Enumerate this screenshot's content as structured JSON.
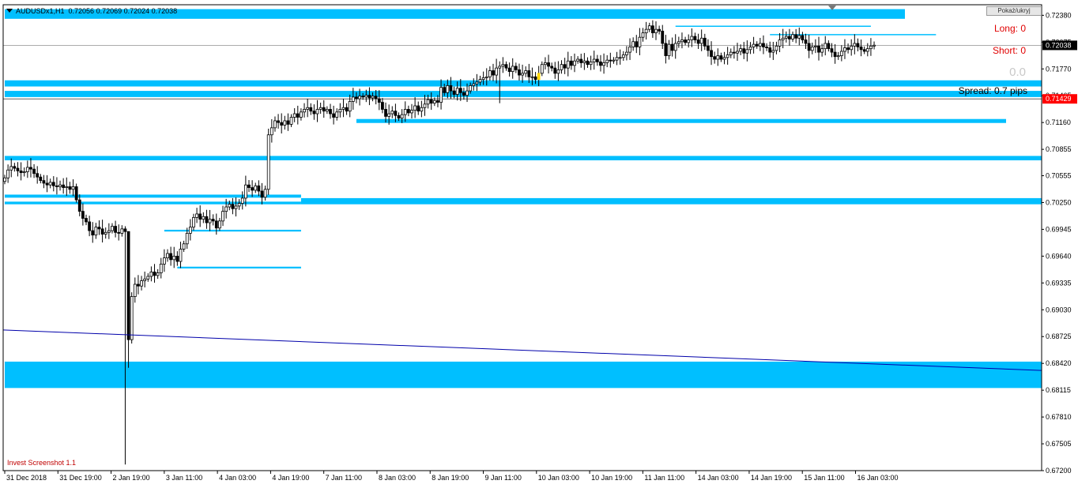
{
  "header": {
    "symbol": "AUDUSDx1,H1",
    "ohlc": "0.72056 0.72069 0.72024 0.72038"
  },
  "toggle_label": "Pokaż/ukryj",
  "panel": {
    "long": "Long: 0",
    "short": "Short: 0",
    "pips_value": "0.0",
    "spread": "Spread: 0.7 pips"
  },
  "branding": "Invest Screenshot 1.1",
  "colors": {
    "zone": "#00bfff",
    "bull": "#ffffff",
    "bear": "#000000",
    "trendline": "#0000aa",
    "current_price_tag": "#000000",
    "red_tag": "#ff0000",
    "pending_candle": "#ffd700"
  },
  "chart_data": {
    "type": "candlestick",
    "symbol": "AUDUSDx1",
    "timeframe": "H1",
    "ylim": [
      0.672,
      0.725
    ],
    "price_ticks": [
      "0.72380",
      "0.72075",
      "0.71770",
      "0.71465",
      "0.71160",
      "0.70855",
      "0.70555",
      "0.70250",
      "0.69945",
      "0.69640",
      "0.69335",
      "0.69030",
      "0.68725",
      "0.68420",
      "0.68115",
      "0.67810",
      "0.67505",
      "0.67200"
    ],
    "time_labels": [
      "31 Dec 2018",
      "31 Dec 19:00",
      "2 Jan 19:00",
      "3 Jan 11:00",
      "4 Jan 03:00",
      "4 Jan 19:00",
      "7 Jan 11:00",
      "8 Jan 03:00",
      "8 Jan 19:00",
      "9 Jan 11:00",
      "10 Jan 03:00",
      "10 Jan 19:00",
      "11 Jan 11:00",
      "14 Jan 03:00",
      "14 Jan 19:00",
      "15 Jan 11:00",
      "16 Jan 03:00"
    ],
    "current_price": "0.72038",
    "red_price_label": "0.71429",
    "closes": [
      0.7053,
      0.7062,
      0.7066,
      0.7064,
      0.7061,
      0.7059,
      0.706,
      0.7065,
      0.7063,
      0.7058,
      0.7054,
      0.705,
      0.7047,
      0.7045,
      0.7048,
      0.7044,
      0.7043,
      0.7045,
      0.7042,
      0.7043,
      0.704,
      0.7043,
      0.7028,
      0.7015,
      0.7007,
      0.7003,
      0.6993,
      0.6988,
      0.6997,
      0.6995,
      0.6989,
      0.6991,
      0.6993,
      0.6998,
      0.6991,
      0.699,
      0.6995,
      0.6992,
      0.6869,
      0.6918,
      0.6932,
      0.693,
      0.6936,
      0.6938,
      0.6941,
      0.6946,
      0.6942,
      0.6945,
      0.6955,
      0.6962,
      0.6967,
      0.696,
      0.6964,
      0.6958,
      0.6972,
      0.6978,
      0.699,
      0.6997,
      0.7008,
      0.7012,
      0.7006,
      0.7009,
      0.7002,
      0.7006,
      0.7004,
      0.6996,
      0.7004,
      0.7015,
      0.702,
      0.7023,
      0.7018,
      0.7021,
      0.7024,
      0.703,
      0.7045,
      0.7042,
      0.7039,
      0.7044,
      0.7038,
      0.7031,
      0.704,
      0.7102,
      0.711,
      0.7118,
      0.7116,
      0.7113,
      0.7118,
      0.7114,
      0.7122,
      0.7126,
      0.7122,
      0.7128,
      0.7131,
      0.7133,
      0.7129,
      0.7126,
      0.7131,
      0.7133,
      0.7129,
      0.7131,
      0.7126,
      0.7122,
      0.7128,
      0.7131,
      0.7133,
      0.7129,
      0.714,
      0.7145,
      0.7143,
      0.7146,
      0.7145,
      0.7147,
      0.7144,
      0.7146,
      0.7143,
      0.7139,
      0.7131,
      0.7123,
      0.7126,
      0.7129,
      0.7124,
      0.7121,
      0.7125,
      0.7131,
      0.7127,
      0.713,
      0.7135,
      0.7129,
      0.7133,
      0.7137,
      0.7142,
      0.7138,
      0.7141,
      0.7139,
      0.7156,
      0.715,
      0.7158,
      0.7152,
      0.7148,
      0.7155,
      0.715,
      0.7147,
      0.7152,
      0.7158,
      0.716,
      0.7162,
      0.7165,
      0.7167,
      0.7168,
      0.7175,
      0.717,
      0.7178,
      0.718,
      0.7182,
      0.7178,
      0.7174,
      0.718,
      0.7176,
      0.717,
      0.7172,
      0.7175,
      0.7168,
      0.7168,
      0.7165,
      0.7172,
      0.7182,
      0.7184,
      0.718,
      0.7178,
      0.7172,
      0.7176,
      0.7182,
      0.7178,
      0.7186,
      0.7181,
      0.7186,
      0.7188,
      0.7184,
      0.7186,
      0.7182,
      0.7185,
      0.7188,
      0.7185,
      0.7181,
      0.7184,
      0.7187,
      0.7186,
      0.7187,
      0.719,
      0.719,
      0.7193,
      0.7196,
      0.7202,
      0.7208,
      0.7202,
      0.7213,
      0.7218,
      0.7222,
      0.7226,
      0.7218,
      0.7222,
      0.722,
      0.7206,
      0.7192,
      0.7205,
      0.7198,
      0.7206,
      0.7208,
      0.721,
      0.7207,
      0.721,
      0.7214,
      0.721,
      0.7206,
      0.7212,
      0.7203,
      0.7198,
      0.7191,
      0.7188,
      0.7192,
      0.7188,
      0.719,
      0.7193,
      0.7196,
      0.7195,
      0.7197,
      0.72,
      0.7195,
      0.7199,
      0.7202,
      0.7205,
      0.7203,
      0.7206,
      0.7202,
      0.7201,
      0.7196,
      0.7198,
      0.7203,
      0.721,
      0.7212,
      0.7214,
      0.7211,
      0.7216,
      0.7212,
      0.7215,
      0.721,
      0.7206,
      0.7198,
      0.7202,
      0.7203,
      0.7196,
      0.72,
      0.7206,
      0.72,
      0.7196,
      0.7191,
      0.7192,
      0.7197,
      0.7201,
      0.7199,
      0.7203,
      0.7206,
      0.7202,
      0.7199,
      0.7197,
      0.72,
      0.7203,
      0.7204
    ],
    "zones": [
      {
        "top": 0.7245,
        "bottom": 0.7234,
        "start": 0,
        "end": "full"
      },
      {
        "top": 0.7164,
        "bottom": 0.7157,
        "start": 0,
        "end": "edge"
      },
      {
        "top": 0.7152,
        "bottom": 0.7145,
        "start": 0,
        "end": "edge"
      },
      {
        "top": 0.712,
        "bottom": 0.71155,
        "start": 108,
        "end": 4
      },
      {
        "top": 0.7078,
        "bottom": 0.7073,
        "start": 0,
        "end": "edge"
      },
      {
        "top": 0.7034,
        "bottom": 0.70305,
        "start": 0,
        "end": 91
      },
      {
        "top": 0.703,
        "bottom": 0.7023,
        "start": 91,
        "end": "edge"
      },
      {
        "top": 0.7026,
        "bottom": 0.7023,
        "start": 0,
        "end": 91
      },
      {
        "top": 0.6994,
        "bottom": 0.6992,
        "start": 49,
        "end": 91
      },
      {
        "top": 0.6952,
        "bottom": 0.695,
        "start": 53,
        "end": 91
      },
      {
        "top": 0.6844,
        "bottom": 0.6814,
        "start": 0,
        "end": "edge"
      }
    ],
    "thin_lines": [
      {
        "price": 0.72255,
        "start": 206,
        "end": 266
      },
      {
        "price": 0.7216,
        "start": 235,
        "end": 286
      }
    ],
    "trendline": {
      "price_start": 0.688,
      "price_end": 0.6834
    },
    "signal_candle_index": 164
  }
}
